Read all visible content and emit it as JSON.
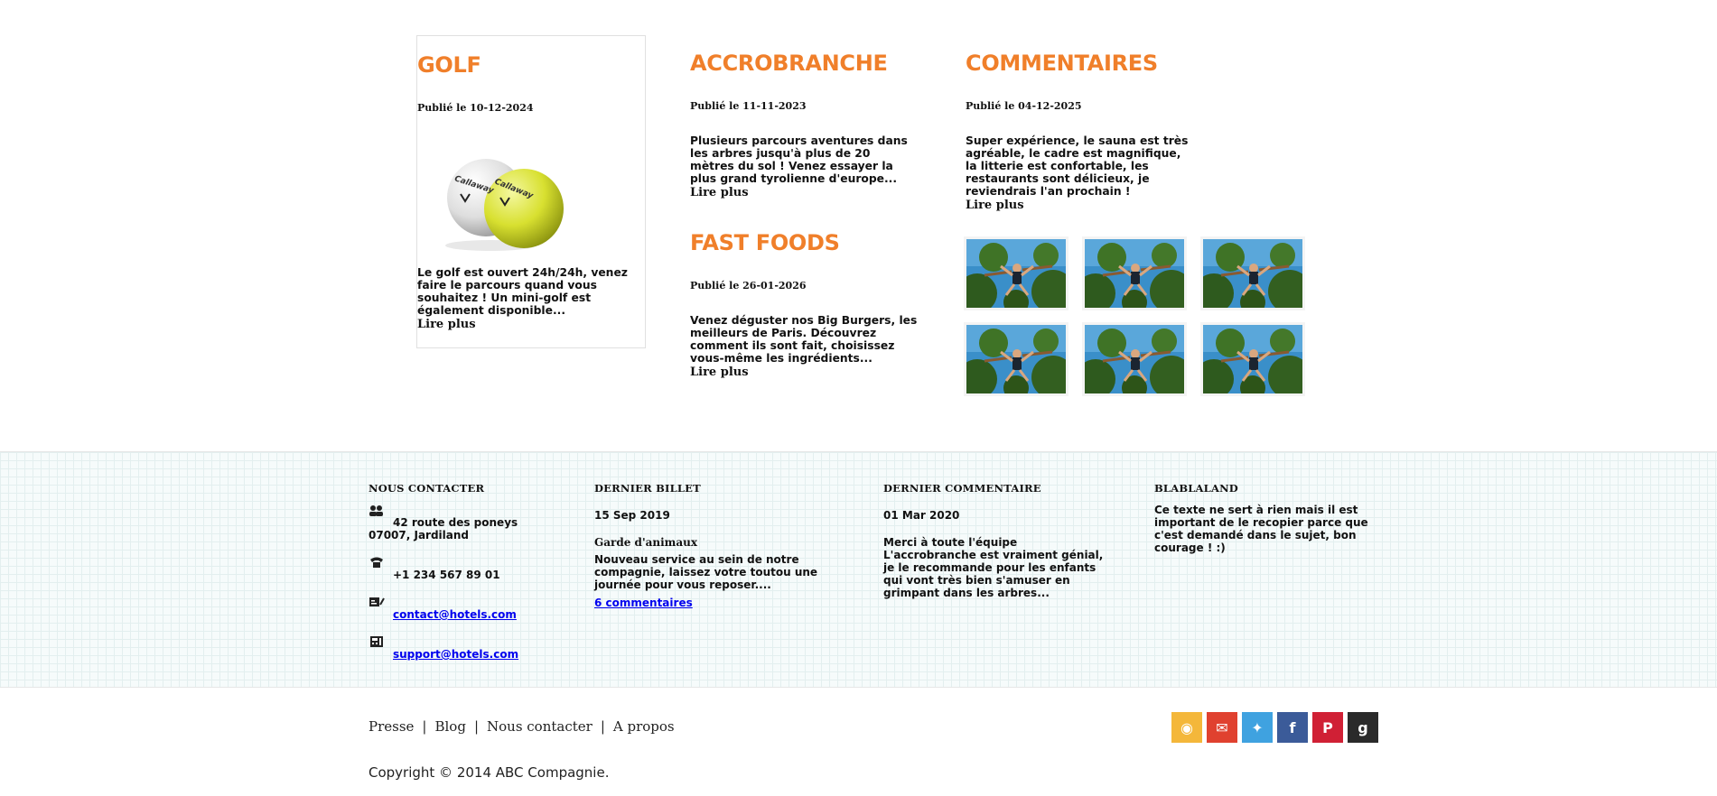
{
  "articles": {
    "golf": {
      "title": "GOLF",
      "date": "Publié le 10-12-2024",
      "text": "Le golf est ouvert 24h/24h, venez faire le parcours quand vous souhaitez ! Un mini-golf est également disponible...",
      "readmore": "Lire plus",
      "ball_brand": "Callaway"
    },
    "accrobranche": {
      "title": "ACCROBRANCHE",
      "date": "Publié le 11-11-2023",
      "text": "Plusieurs parcours aventures dans les arbres jusqu'à plus de 20 mètres du sol ! Venez essayer la plus grand tyrolienne d'europe...",
      "readmore": "Lire plus"
    },
    "fastfoods": {
      "title": "FAST FOODS",
      "date": "Publié le 26-01-2026",
      "text": "Venez déguster nos Big Burgers, les meilleurs de Paris. Découvrez comment ils sont fait, choisissez vous-même les ingrédients...",
      "readmore": "Lire plus"
    },
    "commentaires": {
      "title": "COMMENTAIRES",
      "date": "Publié le 04-12-2025",
      "text": "Super expérience, le sauna est très agréable, le cadre est magnifique, la litterie est confortable, les restaurants sont délicieux, je reviendrais l'an prochain !",
      "readmore": "Lire plus"
    }
  },
  "footer": {
    "contact": {
      "title": "NOUS CONTACTER",
      "address_line1": "42 route des poneys",
      "address_line2": "07007, Jardiland",
      "phone": "+1 234 567 89 01",
      "email": "contact@hotels.com",
      "support": "support@hotels.com",
      "icons": {
        "address": "people-icon",
        "phone": "phone-icon",
        "email": "card-icon",
        "support": "fax-icon"
      }
    },
    "last_post": {
      "title": "DERNIER BILLET",
      "date": "15 Sep 2019",
      "headline": "Garde d'animaux",
      "text": "Nouveau service au sein de notre compagnie, laissez votre toutou une journée pour vous reposer....",
      "comments_link": "6 commentaires"
    },
    "last_comment": {
      "title": "DERNIER COMMENTAIRE",
      "date": "01 Mar 2020",
      "headline": "Merci à toute l'équipe",
      "text": "L'accrobranche est vraiment génial, je le recommande pour les enfants qui vont très bien s'amuser en grimpant dans les arbres..."
    },
    "blabla": {
      "title": "BLABLALAND",
      "text": "Ce texte ne sert à rien mais il est important de le recopier parce que c'est demandé dans le sujet, bon courage ! :)"
    }
  },
  "bottom_nav": {
    "links": [
      "Presse",
      "Blog",
      "Nous contacter",
      "A propos"
    ],
    "separator": "|"
  },
  "social": [
    {
      "name": "rss-icon",
      "color": "#f4b73a",
      "glyph": "◉"
    },
    {
      "name": "mail-icon",
      "color": "#e0412f",
      "glyph": "✉"
    },
    {
      "name": "twitter-icon",
      "color": "#3fa2e0",
      "glyph": "✦"
    },
    {
      "name": "facebook-icon",
      "color": "#3b5b99",
      "glyph": "f"
    },
    {
      "name": "pinterest-icon",
      "color": "#d02035",
      "glyph": "P"
    },
    {
      "name": "google-icon",
      "color": "#2a2a2a",
      "glyph": "g"
    }
  ],
  "copyright": "Copyright © 2014 ABC Compagnie.",
  "colors": {
    "accent": "#f07f2a",
    "link": "#0000ee"
  }
}
